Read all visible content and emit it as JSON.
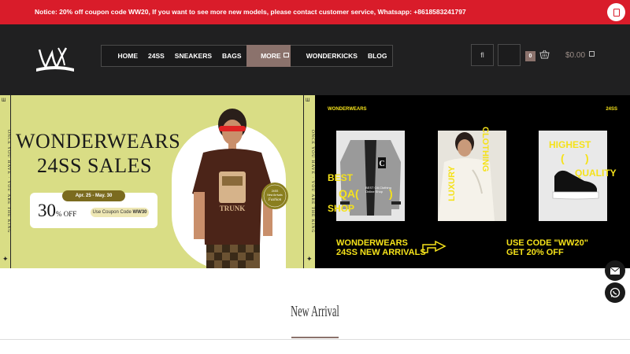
{
  "notice": {
    "text": "Notice: 20% off coupon code WW20, If you want to see more new models, please contact customer service, Whatsapp: +8618583241797",
    "close_icon": "close-icon"
  },
  "nav": {
    "items": [
      {
        "label": "HOME"
      },
      {
        "label": "24SS"
      },
      {
        "label": "SNEAKERS"
      },
      {
        "label": "BAGS"
      },
      {
        "label": "MORE"
      },
      {
        "label": "WONDERKICKS"
      },
      {
        "label": "BLOG"
      }
    ]
  },
  "header": {
    "search_glyph": "fl",
    "cart_count": "0",
    "cart_total": "$0.00"
  },
  "banner_left": {
    "strip_mark": "Ш",
    "strip_text": "ONCE YOU HAVE · YOU ARE THE KING",
    "title_line1": "WONDERWEARS",
    "title_line2": "24SS SALES",
    "date": "Apr. 25 - May. 30",
    "percent": "30",
    "percent_unit": "% OFF",
    "code_prefix": "Use Coupon Code ",
    "code": "WW30",
    "badge_line1": "24SS",
    "badge_line2": "New Arrivals",
    "badge_line3": "Fashion",
    "shirt_text": "TRUNK"
  },
  "banner_right": {
    "brand": "WONDERWEARS",
    "season": "24SS",
    "text_best": "BEST",
    "text_qua": "QA(",
    "text_shop": "SHOP",
    "text_close": ")",
    "text_luxury": "LUXURY",
    "text_clothing": "CLOTHING",
    "text_highest": "HIGHEST",
    "text_paren_open": "(",
    "text_paren_close": ")",
    "text_quality": "QUALITY",
    "bottom_left_line1": "WONDERWEARS",
    "bottom_left_line2": "24SS NEW ARRIVALS",
    "bottom_right_line1": "USE CODE \"WW20\"",
    "bottom_right_line2": "GET 20% OFF",
    "jacket_label": "BEST OA Clothing Online Shop"
  },
  "side_buttons": {
    "email_icon": "email-icon",
    "whatsapp_icon": "whatsapp-icon"
  },
  "section": {
    "title": "New Arrival"
  },
  "colors": {
    "notice_bg": "#d91c2a",
    "header_bg": "#202021",
    "accent": "#8b726c",
    "banner_left_bg": "#d9dd85",
    "banner_right_text": "#f5e21a"
  }
}
